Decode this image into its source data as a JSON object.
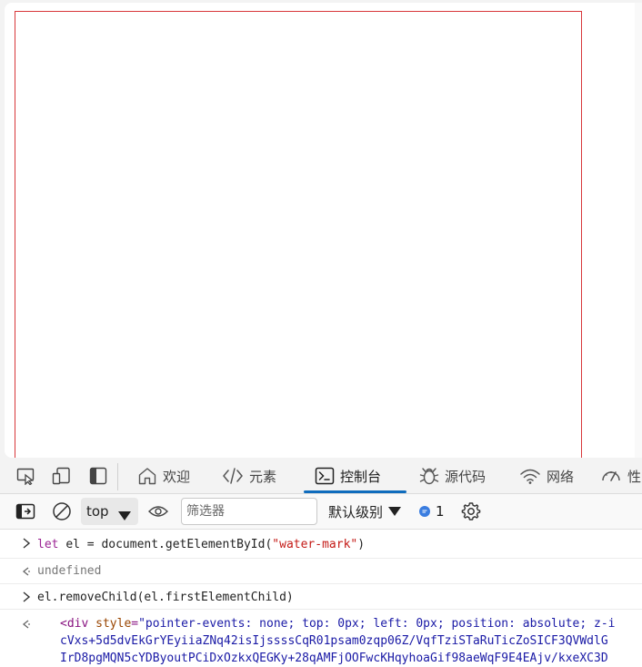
{
  "tabs": {
    "welcome": "欢迎",
    "elements": "元素",
    "console": "控制台",
    "sources": "源代码",
    "network": "网络",
    "performance": "性"
  },
  "toolbar": {
    "context": "top",
    "filter_placeholder": "筛选器",
    "log_level": "默认级别",
    "issues_count": "1"
  },
  "console": {
    "line1_kw": "let",
    "line1_rest": "el = document.getElementById(",
    "line1_str": "\"water-mark\"",
    "line1_end": ")",
    "line2": "undefined",
    "line3": "el.removeChild(el.firstElementChild)",
    "line4_tag_open": "<div",
    "line4_attr": "style",
    "line4_value": "\"pointer-events: none; top: 0px; left: 0px; position: absolute; z-i",
    "line5": "cVxs+5d5dvEkGrYEyiiaZNq42isIjssssCqR01psam0zqp06Z/VqfTziSTaRuTicZoSICF3QVWdlG",
    "line6": "IrD8pgMQN5cYDByoutPCiDxOzkxQEGKy+28qAMFjOOFwcKHqyhoaGif98aeWqF9E4EAjv/kxeXC3D"
  },
  "icons": {
    "inspect": "inspect-icon",
    "device": "device-emulation-icon",
    "panel": "panel-toggle-icon",
    "home": "home-icon",
    "code": "code-icon",
    "console": "console-icon",
    "bug": "bug-icon",
    "wifi": "wifi-icon",
    "gauge": "gauge-icon"
  }
}
